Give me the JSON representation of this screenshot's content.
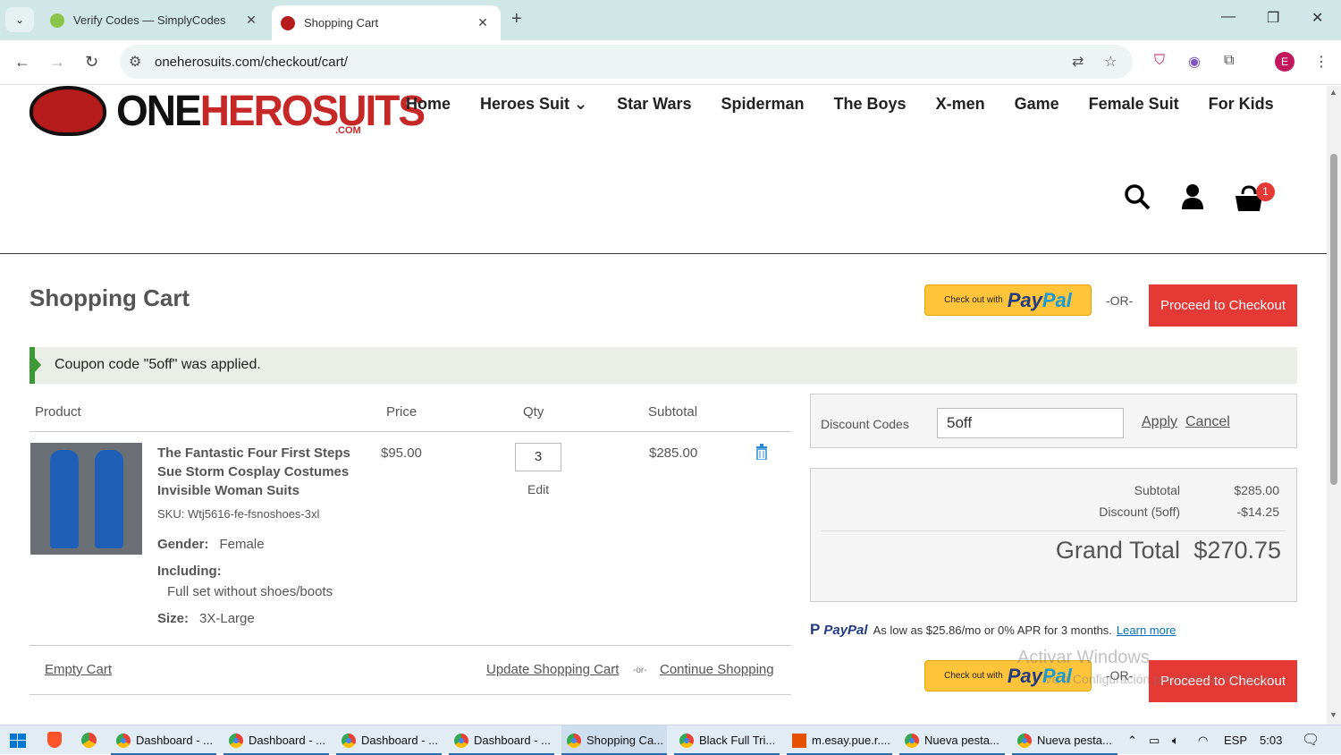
{
  "browser": {
    "tabs": [
      {
        "title": "Verify Codes — SimplyCodes",
        "close": "✕"
      },
      {
        "title": "Shopping Cart",
        "close": "✕"
      }
    ],
    "new_tab": "+",
    "url": "oneherosuits.com/checkout/cart/",
    "profile_initial": "E"
  },
  "site": {
    "logo_one": "ONE",
    "logo_hero": "HEROSUITS",
    "logo_com": ".COM",
    "nav": [
      "Home",
      "Heroes Suit ⌄",
      "Star Wars",
      "Spiderman",
      "The Boys",
      "X-men",
      "Game",
      "Female Suit",
      "For Kids"
    ],
    "cart_count": "1"
  },
  "cart": {
    "title": "Shopping Cart",
    "paypal_checkout_text": "Check out with",
    "paypal_word_1": "Pay",
    "paypal_word_2": "Pal",
    "or_label": "-OR-",
    "proceed_label": "Proceed to Checkout",
    "notice": "Coupon code \"5off\" was applied.",
    "headers": {
      "product": "Product",
      "price": "Price",
      "qty": "Qty",
      "subtotal": "Subtotal"
    },
    "item": {
      "name": "The Fantastic Four First Steps Sue Storm Cosplay Costumes Invisible Woman Suits",
      "sku_label": "SKU:",
      "sku": "Wtj5616-fe-fsnoshoes-3xl",
      "gender_label": "Gender:",
      "gender": "Female",
      "including_label": "Including:",
      "including": "Full set without shoes/boots",
      "size_label": "Size:",
      "size": "3X-Large",
      "price": "$95.00",
      "qty": "3",
      "edit": "Edit",
      "subtotal": "$285.00"
    },
    "empty_cart": "Empty Cart",
    "update_cart": "Update Shopping Cart",
    "small_or": "-or-",
    "continue": "Continue Shopping"
  },
  "discount": {
    "label": "Discount Codes",
    "value": "5off",
    "apply": "Apply",
    "cancel": "Cancel"
  },
  "totals": {
    "subtotal_label": "Subtotal",
    "subtotal": "$285.00",
    "discount_label": "Discount (5off)",
    "discount": "-$14.25",
    "grand_label": "Grand Total",
    "grand": "$270.75"
  },
  "paypal_msg": {
    "logo": "PayPal",
    "text": "As low as $25.86/mo or 0% APR for 3 months.",
    "link": "Learn more"
  },
  "watermark": {
    "line1": "Activar Windows",
    "line2": "Ve a Configuración para activar Windows."
  },
  "taskbar": {
    "items": [
      "Dashboard - ...",
      "Dashboard - ...",
      "Dashboard - ...",
      "Dashboard - ...",
      "Shopping Ca...",
      "Black Full Tri...",
      "m.esay.pue.r....",
      "Nueva pesta...",
      "Nueva pesta..."
    ],
    "lang": "ESP",
    "time": "5:03"
  },
  "colors": {
    "accent_red": "#e53935",
    "paypal_yellow": "#ffc439",
    "notice_green": "#3b9a36"
  }
}
